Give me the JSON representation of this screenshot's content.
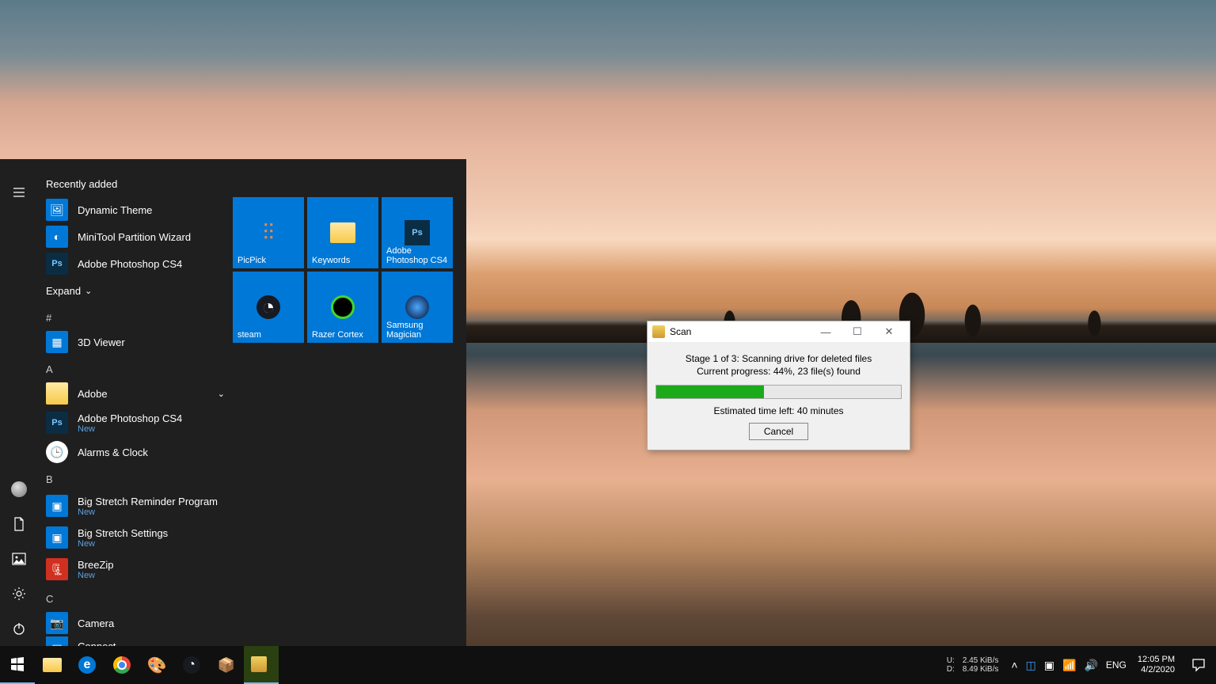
{
  "start": {
    "recently_added_label": "Recently added",
    "recent": [
      {
        "name": "Dynamic Theme"
      },
      {
        "name": "MiniTool Partition Wizard"
      },
      {
        "name": "Adobe Photoshop CS4"
      }
    ],
    "expand_label": "Expand",
    "letters": {
      "hash": "#",
      "a": "A",
      "b": "B",
      "c": "C"
    },
    "apps_hash": [
      {
        "name": "3D Viewer"
      }
    ],
    "apps_a_folder": "Adobe",
    "apps_a": [
      {
        "name": "Adobe Photoshop CS4",
        "sub": "New"
      },
      {
        "name": "Alarms & Clock"
      }
    ],
    "apps_b": [
      {
        "name": "Big Stretch Reminder Program",
        "sub": "New"
      },
      {
        "name": "Big Stretch Settings",
        "sub": "New"
      },
      {
        "name": "BreeZip",
        "sub": "New"
      }
    ],
    "apps_c": [
      {
        "name": "Camera"
      },
      {
        "name": "Connect"
      }
    ],
    "tiles": [
      {
        "label": "PicPick",
        "icon": "picpick"
      },
      {
        "label": "Keywords",
        "icon": "folder"
      },
      {
        "label": "Adobe Photoshop CS4",
        "icon": "ps"
      },
      {
        "label": "steam",
        "icon": "steam"
      },
      {
        "label": "Razer Cortex",
        "icon": "razer"
      },
      {
        "label": "Samsung Magician",
        "icon": "samsung"
      }
    ]
  },
  "scan": {
    "title": "Scan",
    "stage": "Stage 1 of 3: Scanning drive for deleted files",
    "progress_text": "Current progress: 44%, 23 file(s) found",
    "progress_percent": 44,
    "eta": "Estimated time left: 40 minutes",
    "cancel": "Cancel"
  },
  "taskbar": {
    "net": {
      "u_label": "U:",
      "u_val": "2.45 KiB/s",
      "d_label": "D:",
      "d_val": "8.49 KiB/s"
    },
    "lang": "ENG",
    "time": "12:05 PM",
    "date": "4/2/2020"
  }
}
